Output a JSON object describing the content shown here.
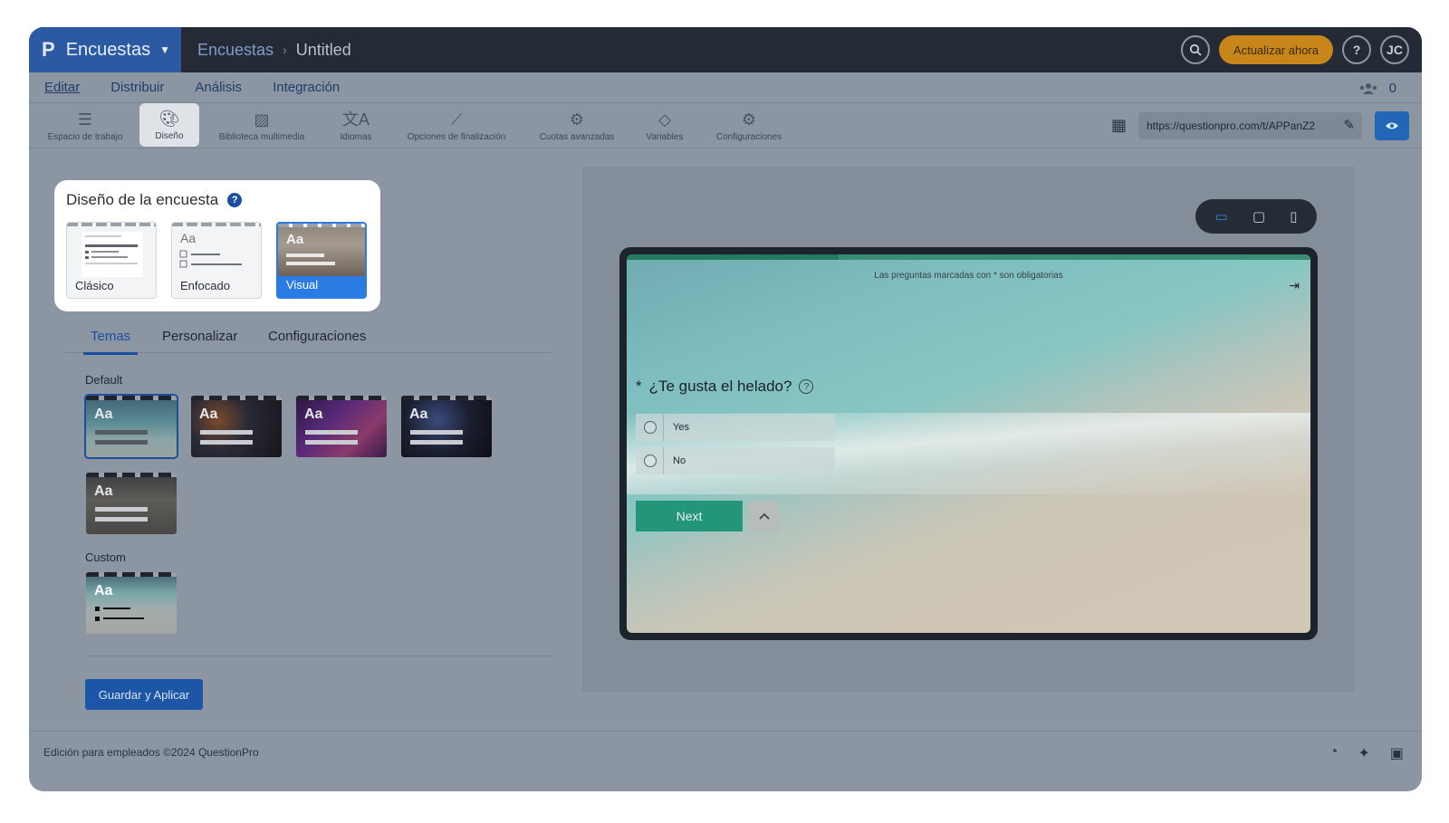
{
  "topbar": {
    "brand_logo": "P",
    "brand_label": "Encuestas",
    "breadcrumb_parent": "Encuestas",
    "breadcrumb_current": "Untitled",
    "upgrade_label": "Actualizar ahora",
    "help_label": "?",
    "avatar_initials": "JC"
  },
  "menu": {
    "items": [
      "Editar",
      "Distribuir",
      "Análisis",
      "Integración"
    ],
    "active": "Editar",
    "users_count": "0"
  },
  "toolbar": {
    "tools": [
      {
        "label": "Espacio de trabajo",
        "icon": "workspace-icon"
      },
      {
        "label": "Diseño",
        "icon": "palette-icon"
      },
      {
        "label": "Biblioteca multimedia",
        "icon": "image-icon"
      },
      {
        "label": "Idiomas",
        "icon": "translate-icon"
      },
      {
        "label": "Opciones de finalización",
        "icon": "magic-wand-icon"
      },
      {
        "label": "Cuotas avanzadas",
        "icon": "quota-icon"
      },
      {
        "label": "Variables",
        "icon": "tag-icon"
      },
      {
        "label": "Configuraciones",
        "icon": "gear-icon"
      }
    ],
    "active_tool": "Diseño",
    "url": "https://questionpro.com/t/APPanZ2"
  },
  "design": {
    "title": "Diseño de la encuesta",
    "layouts": [
      {
        "label": "Clásico"
      },
      {
        "label": "Enfocado"
      },
      {
        "label": "Visual"
      }
    ],
    "selected_layout": "Visual",
    "tabs": [
      "Temas",
      "Personalizar",
      "Configuraciones"
    ],
    "active_tab": "Temas",
    "default_label": "Default",
    "custom_label": "Custom",
    "theme_sample": "Aa",
    "save_label": "Guardar y Aplicar"
  },
  "preview": {
    "required_note": "Las preguntas marcadas con * son obligatorias",
    "question_marker": "*",
    "question_text": "¿Te gusta el helado?",
    "question_help": "?",
    "options": [
      "Yes",
      "No"
    ],
    "next_label": "Next",
    "progress": 0.31
  },
  "footer": {
    "copyright": "Edición para empleados ©2024 QuestionPro"
  },
  "colors": {
    "brand": "#2c5aa2",
    "accent": "#2a7be4",
    "upgrade": "#c8861a",
    "survey_button": "#23967a"
  }
}
